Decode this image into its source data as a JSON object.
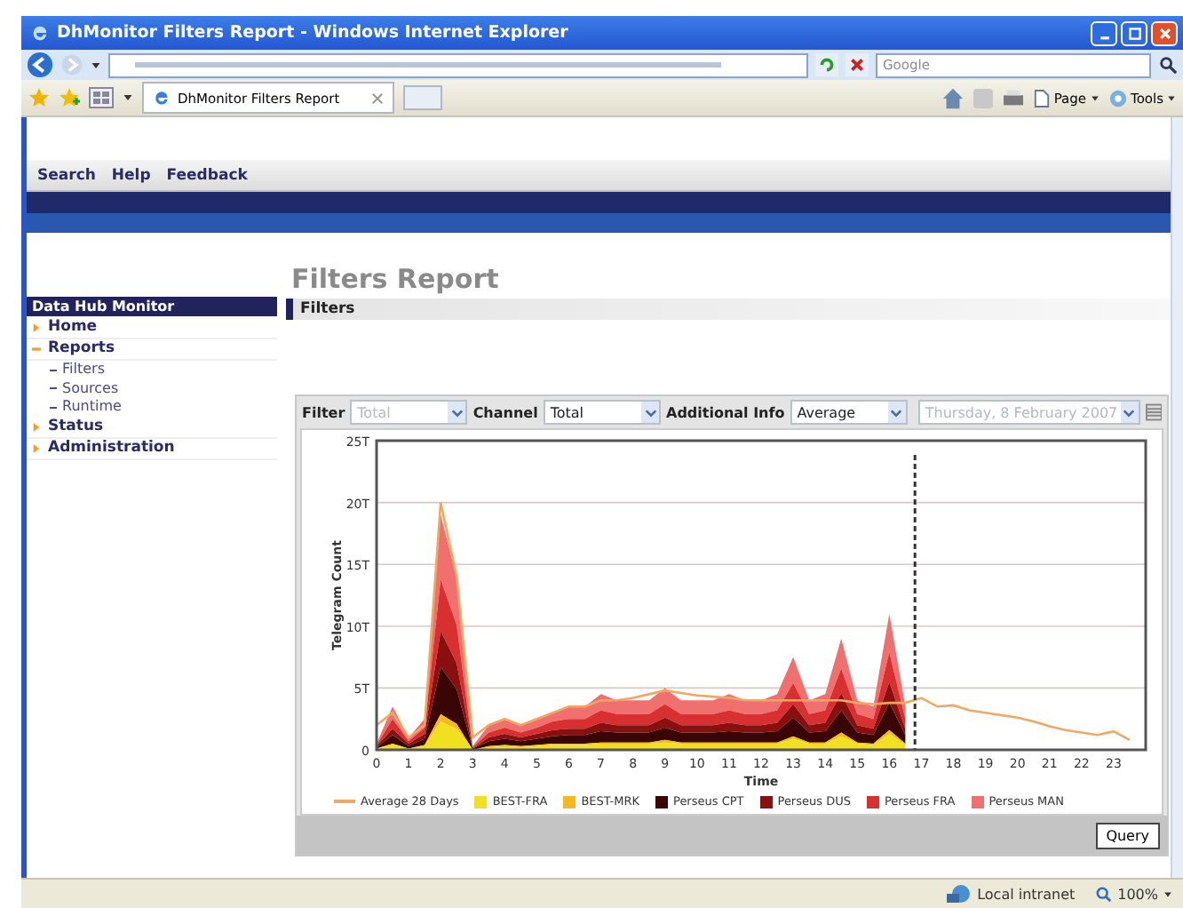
{
  "window": {
    "title": "DhMonitor Filters Report - Windows Internet Explorer"
  },
  "search": {
    "placeholder": "Google"
  },
  "browser_tab": {
    "label": "DhMonitor Filters Report"
  },
  "command_bar": [
    "Page",
    "Tools"
  ],
  "nav_tabs": [
    {
      "label": "Search"
    },
    {
      "label": "Help"
    },
    {
      "label": "Feedback"
    }
  ],
  "page_title": "Filters Report",
  "sidebar": {
    "title": "Data Hub Monitor",
    "items": [
      {
        "label": "Home",
        "expanded": false
      },
      {
        "label": "Reports",
        "expanded": true,
        "children": [
          {
            "label": "Filters"
          },
          {
            "label": "Sources"
          },
          {
            "label": "Runtime"
          }
        ]
      },
      {
        "label": "Status",
        "expanded": false
      },
      {
        "label": "Administration",
        "expanded": false
      }
    ]
  },
  "section_title": "Filters",
  "filters": [
    {
      "label": "Filter",
      "value": "Total",
      "disabled": true
    },
    {
      "label": "Channel",
      "value": "Total",
      "disabled": false
    },
    {
      "label": "Additional Info",
      "value": "Average",
      "disabled": false
    },
    {
      "value": "Thursday, 8 February 2007",
      "disabled": true
    }
  ],
  "chart_data": {
    "type": "area",
    "stacked": true,
    "xlabel": "Time",
    "ylabel": "Telegram Count",
    "xlim": [
      0,
      24
    ],
    "ylim": [
      0,
      25
    ],
    "yticks": [
      {
        "value": 0,
        "label": "0"
      },
      {
        "value": 5,
        "label": "5T"
      },
      {
        "value": 10,
        "label": "10T"
      },
      {
        "value": 15,
        "label": "15T"
      },
      {
        "value": 20,
        "label": "20T"
      },
      {
        "value": 25,
        "label": "25T"
      }
    ],
    "xticks": [
      0,
      1,
      2,
      3,
      4,
      5,
      6,
      7,
      8,
      9,
      10,
      11,
      12,
      13,
      14,
      15,
      16,
      17,
      18,
      19,
      20,
      21,
      22,
      23
    ],
    "x": [
      0,
      0.5,
      1,
      1.5,
      2,
      2.5,
      3,
      3.5,
      4,
      4.5,
      5,
      5.5,
      6,
      6.5,
      7,
      7.5,
      8,
      8.5,
      9,
      9.5,
      10,
      10.5,
      11,
      11.5,
      12,
      12.5,
      13,
      13.5,
      14,
      14.5,
      15,
      15.5,
      16,
      16.5,
      17,
      17.5,
      18,
      18.5,
      19,
      19.5,
      20,
      20.5,
      21,
      21.5,
      22,
      22.5,
      23,
      23.5
    ],
    "series": [
      {
        "name": "Average 28 Days",
        "type": "line",
        "color": "#f0a860",
        "values": [
          2,
          3,
          1,
          2,
          20,
          14,
          1,
          2,
          2.5,
          2,
          2.5,
          3,
          3.5,
          3.5,
          4,
          4,
          4.2,
          4.5,
          4.8,
          4.6,
          4.4,
          4.3,
          4.2,
          4,
          4,
          4,
          4,
          4,
          4,
          4,
          3.8,
          3.7,
          3.8,
          3.8,
          4.2,
          3.5,
          3.6,
          3.2,
          3,
          2.8,
          2.6,
          2.3,
          1.9,
          1.6,
          1.4,
          1.2,
          1.5,
          0.8
        ]
      },
      {
        "name": "BEST-FRA",
        "type": "area",
        "color": "#f0e020",
        "values": [
          0.1,
          0.4,
          0.1,
          0.3,
          2.3,
          1.7,
          0,
          0.2,
          0.3,
          0.2,
          0.3,
          0.4,
          0.4,
          0.4,
          0.5,
          0.5,
          0.5,
          0.5,
          0.6,
          0.5,
          0.5,
          0.5,
          0.5,
          0.5,
          0.5,
          0.5,
          0.9,
          0.5,
          0.5,
          1.1,
          0.5,
          0.4,
          1.3,
          0.4,
          null,
          null,
          null,
          null,
          null,
          null,
          null,
          null,
          null,
          null,
          null,
          null,
          null,
          null
        ]
      },
      {
        "name": "BEST-MRK",
        "type": "area",
        "color": "#f5b820",
        "values": [
          0,
          0.1,
          0,
          0.1,
          0.6,
          0.4,
          0,
          0.1,
          0.1,
          0.1,
          0.1,
          0.1,
          0.1,
          0.1,
          0.1,
          0.1,
          0.1,
          0.1,
          0.2,
          0.1,
          0.1,
          0.1,
          0.1,
          0.1,
          0.1,
          0.1,
          0.2,
          0.1,
          0.1,
          0.3,
          0.1,
          0.1,
          0.3,
          0.1,
          null,
          null,
          null,
          null,
          null,
          null,
          null,
          null,
          null,
          null,
          null,
          null,
          null,
          null
        ]
      },
      {
        "name": "Perseus CPT",
        "type": "area",
        "color": "#3a0505",
        "values": [
          0.1,
          0.7,
          0.2,
          0.5,
          3.8,
          2.8,
          0.1,
          0.4,
          0.5,
          0.4,
          0.5,
          0.6,
          0.7,
          0.7,
          0.9,
          0.8,
          0.8,
          0.8,
          1,
          0.8,
          0.8,
          0.8,
          0.9,
          0.8,
          0.8,
          0.9,
          1.5,
          0.8,
          0.9,
          1.8,
          0.8,
          0.7,
          2.2,
          0.7,
          null,
          null,
          null,
          null,
          null,
          null,
          null,
          null,
          null,
          null,
          null,
          null,
          null,
          null
        ]
      },
      {
        "name": "Perseus DUS",
        "type": "area",
        "color": "#8a1010",
        "values": [
          0.1,
          0.5,
          0.2,
          0.4,
          2.9,
          2.1,
          0,
          0.3,
          0.4,
          0.3,
          0.4,
          0.5,
          0.5,
          0.5,
          0.7,
          0.6,
          0.6,
          0.6,
          0.8,
          0.6,
          0.6,
          0.6,
          0.7,
          0.6,
          0.6,
          0.7,
          1.1,
          0.6,
          0.7,
          1.4,
          0.6,
          0.5,
          1.7,
          0.5,
          null,
          null,
          null,
          null,
          null,
          null,
          null,
          null,
          null,
          null,
          null,
          null,
          null,
          null
        ]
      },
      {
        "name": "Perseus FRA",
        "type": "area",
        "color": "#d83030",
        "values": [
          0.1,
          0.8,
          0.2,
          0.5,
          4.2,
          3.1,
          0.1,
          0.4,
          0.5,
          0.4,
          0.5,
          0.7,
          0.8,
          0.8,
          1,
          0.9,
          0.9,
          0.9,
          1.1,
          0.9,
          0.9,
          0.9,
          1,
          0.9,
          0.9,
          1,
          1.7,
          0.9,
          1,
          2,
          0.9,
          0.8,
          2.4,
          0.8,
          null,
          null,
          null,
          null,
          null,
          null,
          null,
          null,
          null,
          null,
          null,
          null,
          null,
          null
        ]
      },
      {
        "name": "Perseus MAN",
        "type": "area",
        "color": "#f07070",
        "values": [
          0.1,
          1,
          0.3,
          0.7,
          5.2,
          3.9,
          0.1,
          0.6,
          0.7,
          0.6,
          0.7,
          0.7,
          1,
          1,
          1.3,
          1.1,
          1.1,
          1.1,
          1.3,
          1.1,
          1.1,
          1.1,
          1.3,
          1.1,
          1.1,
          1.3,
          2.1,
          1.1,
          1.3,
          2.4,
          1.1,
          1,
          3.1,
          1,
          null,
          null,
          null,
          null,
          null,
          null,
          null,
          null,
          null,
          null,
          null,
          null,
          null,
          null
        ]
      }
    ],
    "grid": true,
    "legend": "bottom",
    "ref_lines": [
      {
        "axis": "x",
        "value": 16.8,
        "color": "#333333"
      }
    ]
  },
  "query_button": "Query",
  "status_bar": {
    "zone": "Local intranet",
    "zoom": "100%"
  }
}
